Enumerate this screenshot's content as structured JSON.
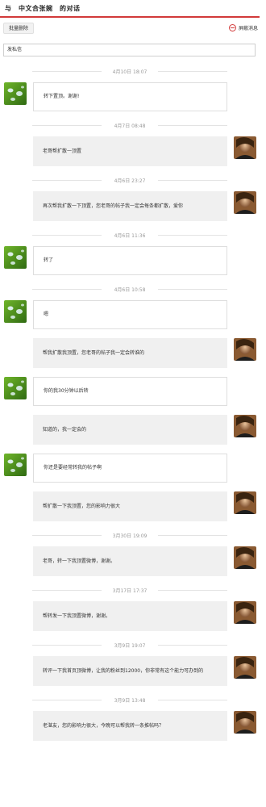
{
  "header": {
    "title": "与　中文合张婉　的对话"
  },
  "toolbar": {
    "batch_delete": "批量删除",
    "block": "屏蔽消息"
  },
  "composer": {
    "value": "发私信"
  },
  "messages": [
    {
      "time": "4月10日 18:07"
    },
    {
      "side": "in",
      "text": "转下置顶。谢谢!"
    },
    {
      "time": "4月7日 08:48"
    },
    {
      "side": "out",
      "text": "老哥帮扩散一顶置"
    },
    {
      "time": "4月6日 23:27"
    },
    {
      "side": "out",
      "text": "再次帮我扩散一下顶置，您老哥的帖子我一定会每条都扩散，爱你"
    },
    {
      "time": "4月6日 11:36"
    },
    {
      "side": "in",
      "text": "转了"
    },
    {
      "time": "4月6日 10:58"
    },
    {
      "side": "in",
      "text": "嗯"
    },
    {
      "side": "out",
      "text": "帮我扩散我顶置，您老哥的帖子我一定会转谁的"
    },
    {
      "side": "in",
      "text": "你的我30分钟以后转"
    },
    {
      "side": "out",
      "text": "知道的，我一定会的"
    },
    {
      "side": "in",
      "text": "你还是要经常转我的帖子啊"
    },
    {
      "side": "out",
      "text": "帮扩散一下我顶置，您的影响力很大"
    },
    {
      "time": "3月30日 19:09"
    },
    {
      "side": "out",
      "text": "老哥，转一下我顶置微博，谢谢。"
    },
    {
      "time": "3月17日 17:37"
    },
    {
      "side": "out",
      "text": "帮转发一下我顶置微博，谢谢。"
    },
    {
      "time": "3月9日 19:07"
    },
    {
      "side": "out",
      "text": "转评一下我首页顶微博，让我的粉丝到12000，你非常有这个能力可办到的"
    },
    {
      "time": "3月9日 13:48"
    },
    {
      "side": "out",
      "text": "老湛友，您的影响力很大，今晚可以帮我转一条推帖吗？"
    }
  ]
}
